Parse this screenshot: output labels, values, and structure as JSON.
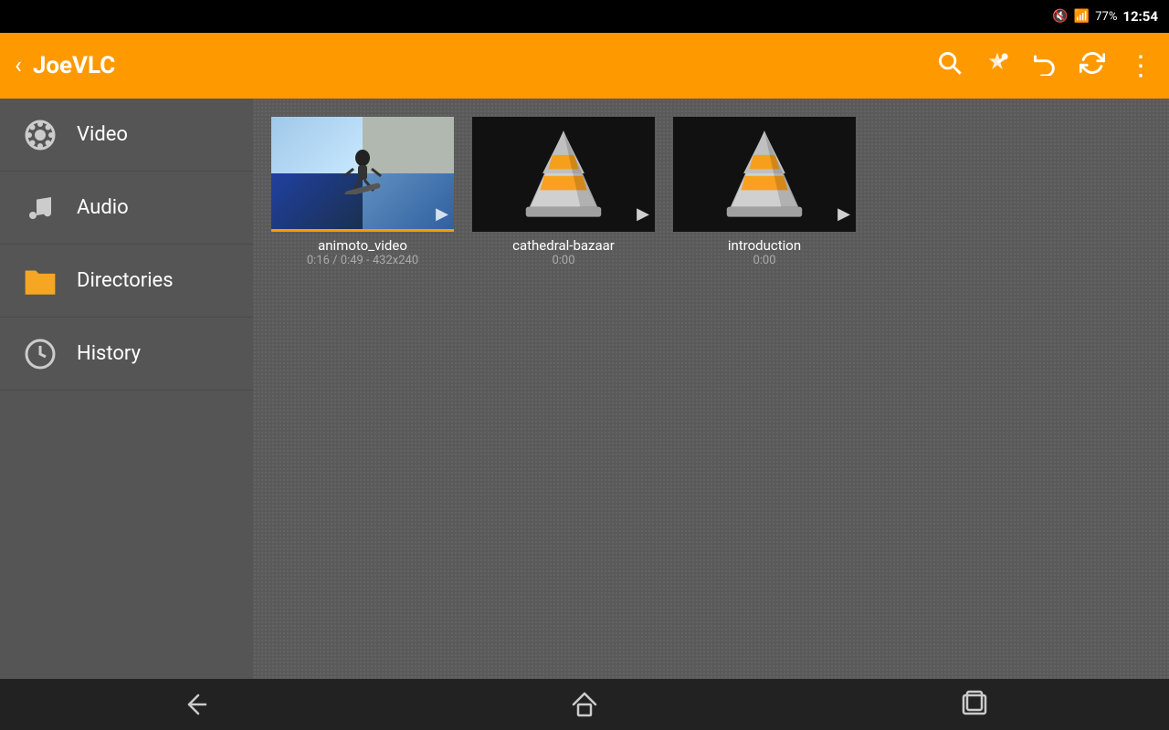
{
  "statusBar": {
    "time": "12:54",
    "battery": "77"
  },
  "appBar": {
    "title": "JoeVLC",
    "backLabel": "‹",
    "actions": {
      "search": "search",
      "settings": "settings",
      "back": "back",
      "refresh": "refresh",
      "more": "more"
    }
  },
  "sidebar": {
    "items": [
      {
        "id": "video",
        "label": "Video",
        "icon": "film"
      },
      {
        "id": "audio",
        "label": "Audio",
        "icon": "music"
      },
      {
        "id": "directories",
        "label": "Directories",
        "icon": "folder"
      },
      {
        "id": "history",
        "label": "History",
        "icon": "clock"
      }
    ]
  },
  "mediaItems": [
    {
      "title": "animoto_video",
      "meta": "0:16 / 0:49 - 432x240",
      "type": "video",
      "thumbnail": "snowboard"
    },
    {
      "title": "cathedral-bazaar",
      "meta": "0:00",
      "type": "video",
      "thumbnail": "vlc"
    },
    {
      "title": "introduction",
      "meta": "0:00",
      "type": "video",
      "thumbnail": "vlc"
    }
  ],
  "navBar": {
    "back": "←",
    "home": "⌂",
    "recents": "▭"
  }
}
